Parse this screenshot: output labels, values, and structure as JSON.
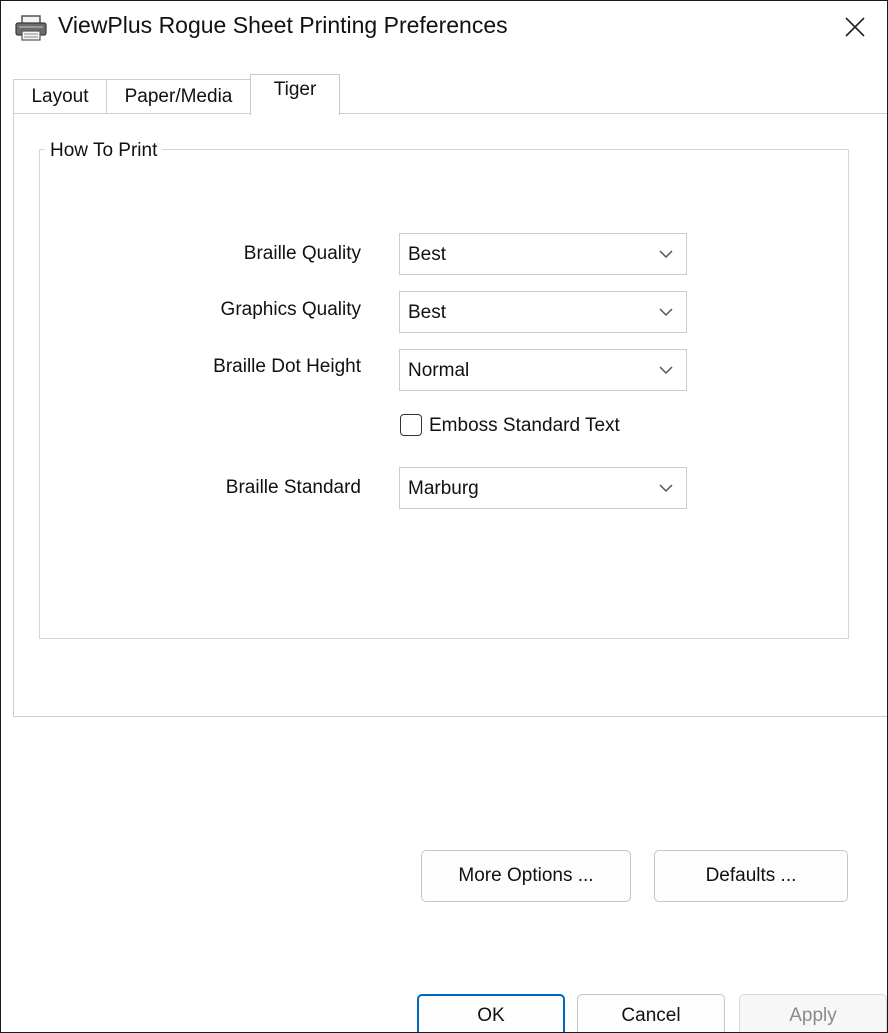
{
  "window": {
    "title": "ViewPlus Rogue Sheet Printing Preferences",
    "title_icon": "printer-icon",
    "close_icon": "close-icon"
  },
  "tabs": [
    {
      "label": "Layout",
      "active": false
    },
    {
      "label": "Paper/Media",
      "active": false
    },
    {
      "label": "Tiger",
      "active": true
    }
  ],
  "how_to_print": {
    "legend": "How To Print",
    "braille_quality": {
      "label": "Braille Quality",
      "value": "Best"
    },
    "graphics_quality": {
      "label": "Graphics Quality",
      "value": "Best"
    },
    "braille_dot_height": {
      "label": "Braille Dot Height",
      "value": "Normal"
    },
    "emboss_standard_text": {
      "label": "Emboss Standard Text",
      "checked": false
    },
    "braille_standard": {
      "label": "Braille Standard",
      "value": "Marburg"
    }
  },
  "panel_buttons": {
    "more_options": "More Options ...",
    "defaults": "Defaults ..."
  },
  "dialog_buttons": {
    "ok": "OK",
    "cancel": "Cancel",
    "apply": "Apply",
    "apply_enabled": false
  },
  "colors": {
    "ok_border": "#0067c0",
    "disabled_text": "#8a8a8a"
  }
}
